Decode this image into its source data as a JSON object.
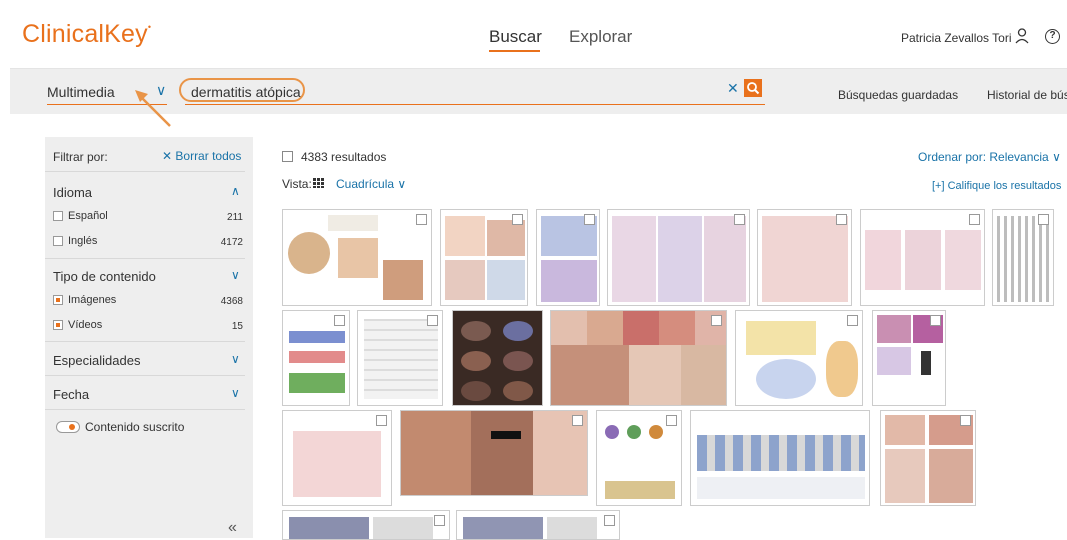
{
  "header": {
    "logo": "ClinicalKey",
    "nav": {
      "search": "Buscar",
      "explore": "Explorar"
    },
    "user_name": "Patricia Zevallos Tori",
    "help_glyph": "?"
  },
  "searchbar": {
    "type_value": "Multimedia",
    "query": "dermatitis atópica",
    "clear_glyph": "✕",
    "saved_searches": "Búsquedas guardadas",
    "history": "Historial de bús"
  },
  "sidebar": {
    "filter_by": "Filtrar por:",
    "clear_all": "✕ Borrar todos",
    "sections": {
      "language": {
        "title": "Idioma",
        "items": [
          {
            "label": "Español",
            "count": "211",
            "checked": false
          },
          {
            "label": "Inglés",
            "count": "4172",
            "checked": false
          }
        ]
      },
      "content_type": {
        "title": "Tipo de contenido",
        "items": [
          {
            "label": "Imágenes",
            "count": "4368",
            "checked": true
          },
          {
            "label": "Vídeos",
            "count": "15",
            "checked": true
          }
        ]
      },
      "specialties": {
        "title": "Especialidades"
      },
      "date": {
        "title": "Fecha"
      }
    },
    "subscribed_toggle": "Contenido suscrito",
    "collapse_glyph": "«"
  },
  "results": {
    "count_text": "4383 resultados",
    "sort": "Ordenar por: Relevancia ∨",
    "view_label": "Vista:",
    "view_mode": "Cuadrícula ∨",
    "rate": "[+] Califique los resultados"
  },
  "colors": {
    "accent": "#e9711c",
    "link": "#1a73a8",
    "panel": "#eeeeee"
  }
}
